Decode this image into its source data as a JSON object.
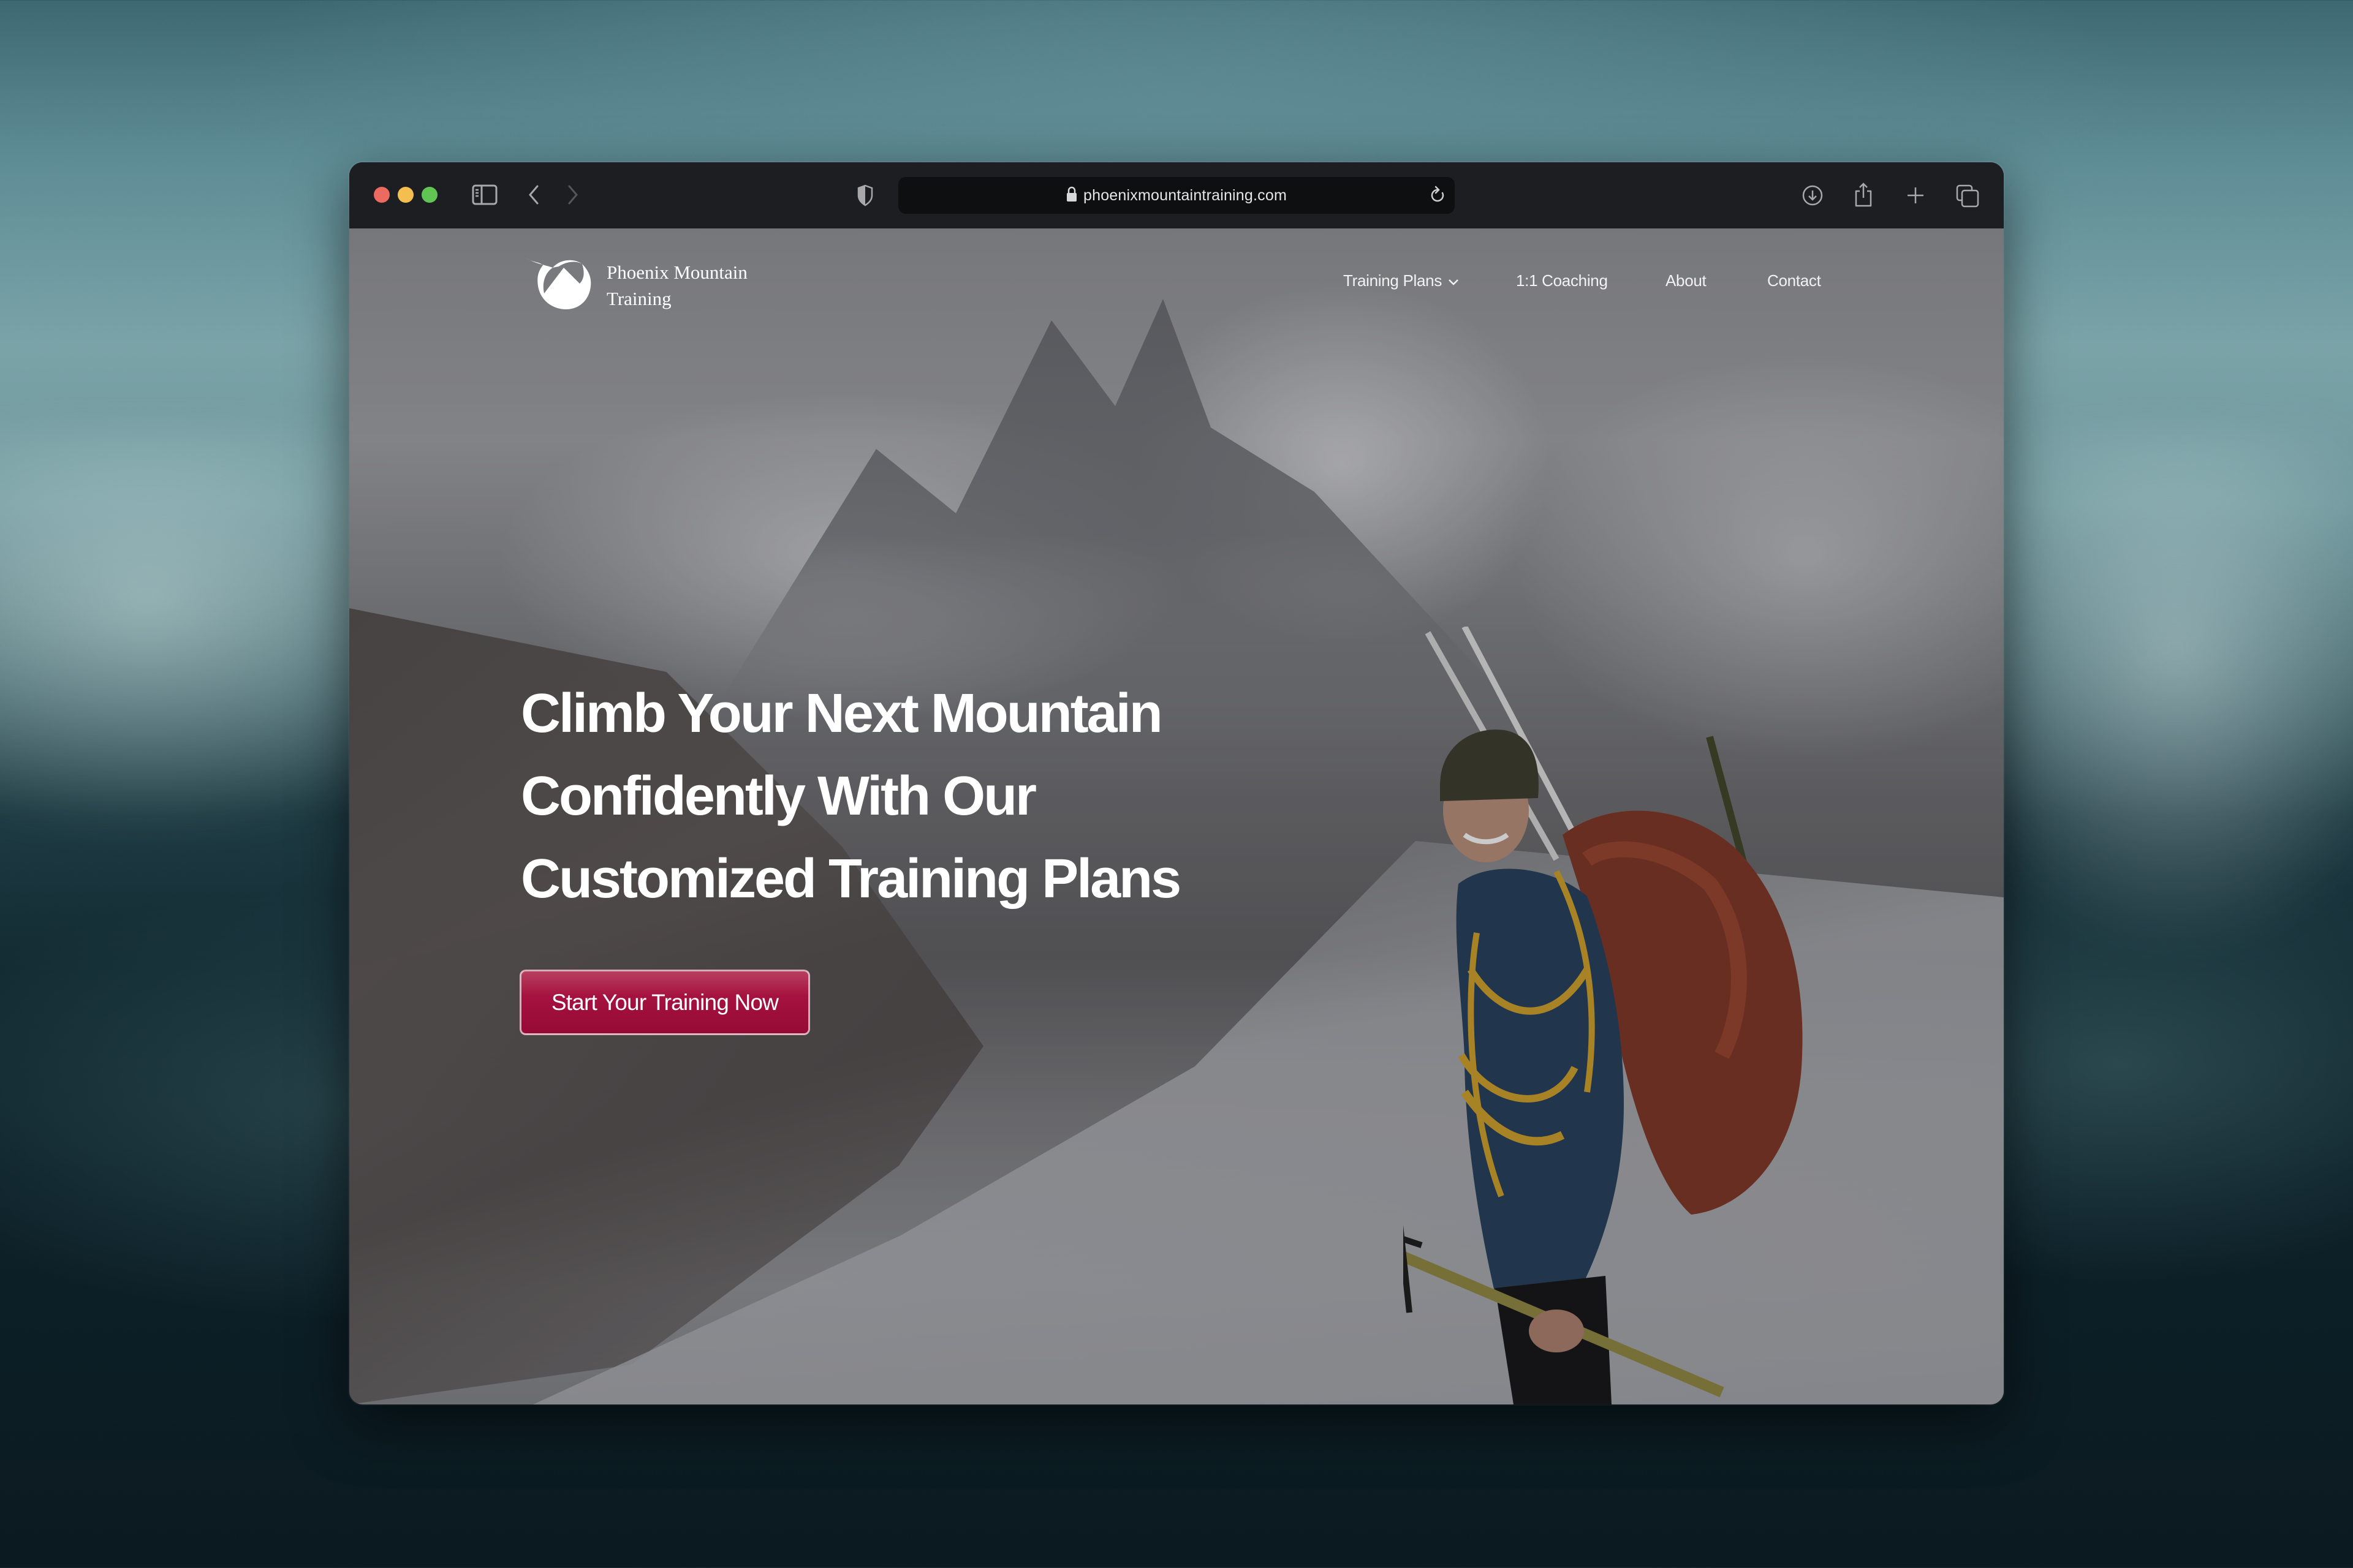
{
  "browser": {
    "url": "phoenixmountaintraining.com",
    "icons": {
      "close": "close-traffic-light",
      "minimize": "minimize-traffic-light",
      "maximize": "maximize-traffic-light",
      "sidebar": "sidebar-icon",
      "back": "chevron-left-icon",
      "forward": "chevron-right-icon",
      "privacy": "shield-icon",
      "lock": "lock-icon",
      "reload": "reload-icon",
      "download": "download-icon",
      "share": "share-icon",
      "new_tab": "plus-icon",
      "tabs": "tab-overview-icon"
    }
  },
  "site": {
    "logo": {
      "line1": "Phoenix Mountain",
      "line2": "Training",
      "icon": "phoenix-mountain-logo-icon"
    },
    "nav": [
      {
        "label": "Training Plans",
        "has_dropdown": true
      },
      {
        "label": "1:1 Coaching",
        "has_dropdown": false
      },
      {
        "label": "About",
        "has_dropdown": false
      },
      {
        "label": "Contact",
        "has_dropdown": false
      }
    ],
    "hero": {
      "title_lines": [
        "Climb Your Next Mountain",
        "Confidently With Our",
        "Customized Training Plans"
      ],
      "cta_label": "Start Your Training Now",
      "image_description": "Smiling mountaineer with red backpack, yellow rope and ice axe standing above a glacier with cloud-covered peaks"
    },
    "colors": {
      "cta": "#A5123F",
      "toolbar": "#1D1E21",
      "address_bar": "#0D0F11"
    }
  }
}
